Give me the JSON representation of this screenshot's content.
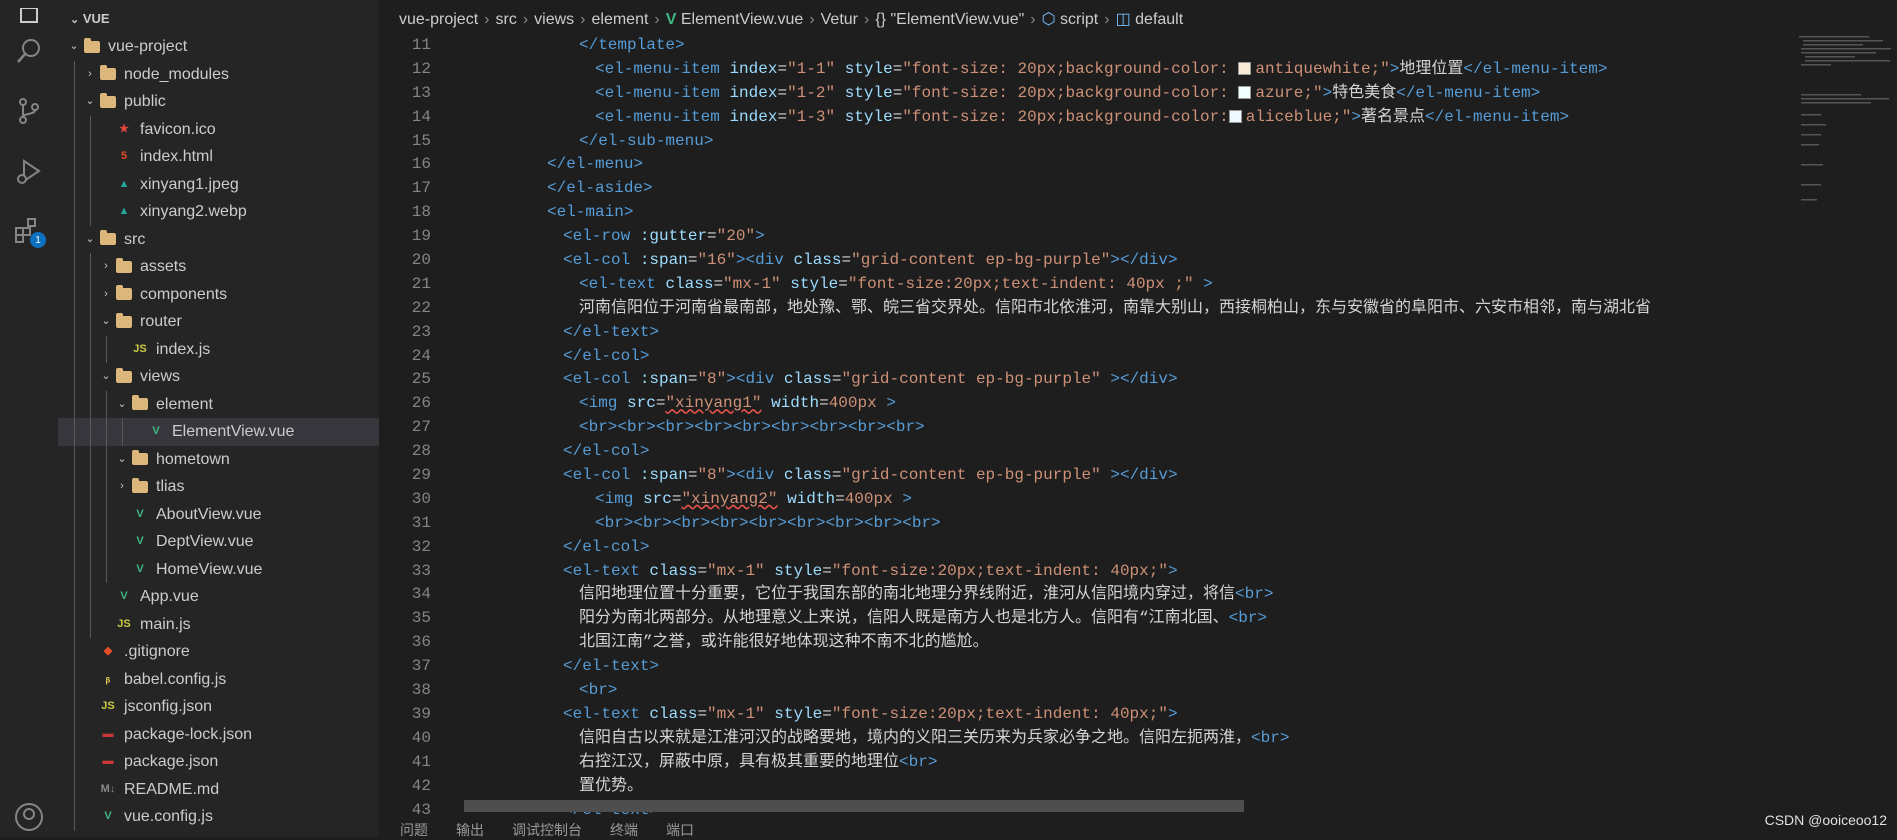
{
  "explorer": {
    "header": "VUE",
    "items": [
      {
        "label": "vue-project",
        "depth": 1,
        "type": "folder",
        "open": true
      },
      {
        "label": "node_modules",
        "depth": 2,
        "type": "folder",
        "open": false
      },
      {
        "label": "public",
        "depth": 2,
        "type": "folder",
        "open": true
      },
      {
        "label": "favicon.ico",
        "depth": 3,
        "type": "favicon"
      },
      {
        "label": "index.html",
        "depth": 3,
        "type": "html"
      },
      {
        "label": "xinyang1.jpeg",
        "depth": 3,
        "type": "image"
      },
      {
        "label": "xinyang2.webp",
        "depth": 3,
        "type": "image"
      },
      {
        "label": "src",
        "depth": 2,
        "type": "folder",
        "open": true
      },
      {
        "label": "assets",
        "depth": 3,
        "type": "folder",
        "open": false
      },
      {
        "label": "components",
        "depth": 3,
        "type": "folder",
        "open": false
      },
      {
        "label": "router",
        "depth": 3,
        "type": "folder",
        "open": true
      },
      {
        "label": "index.js",
        "depth": 4,
        "type": "js"
      },
      {
        "label": "views",
        "depth": 3,
        "type": "folder",
        "open": true
      },
      {
        "label": "element",
        "depth": 4,
        "type": "folder",
        "open": true
      },
      {
        "label": "ElementView.vue",
        "depth": 5,
        "type": "vue",
        "selected": true
      },
      {
        "label": "hometown",
        "depth": 4,
        "type": "folder",
        "open": true
      },
      {
        "label": "tlias",
        "depth": 4,
        "type": "folder",
        "open": false
      },
      {
        "label": "AboutView.vue",
        "depth": 4,
        "type": "vue"
      },
      {
        "label": "DeptView.vue",
        "depth": 4,
        "type": "vue"
      },
      {
        "label": "HomeView.vue",
        "depth": 4,
        "type": "vue"
      },
      {
        "label": "App.vue",
        "depth": 3,
        "type": "vue"
      },
      {
        "label": "main.js",
        "depth": 3,
        "type": "js"
      },
      {
        "label": ".gitignore",
        "depth": 2,
        "type": "git"
      },
      {
        "label": "babel.config.js",
        "depth": 2,
        "type": "babel"
      },
      {
        "label": "jsconfig.json",
        "depth": 2,
        "type": "js"
      },
      {
        "label": "package-lock.json",
        "depth": 2,
        "type": "npm"
      },
      {
        "label": "package.json",
        "depth": 2,
        "type": "npm"
      },
      {
        "label": "README.md",
        "depth": 2,
        "type": "md"
      },
      {
        "label": "vue.config.js",
        "depth": 2,
        "type": "vue"
      }
    ]
  },
  "breadcrumb": [
    "vue-project",
    "src",
    "views",
    "element",
    "ElementView.vue",
    "Vetur",
    "{} \"ElementView.vue\"",
    "script",
    "default"
  ],
  "editor": {
    "lines": [
      {
        "n": "11",
        "indent": 6,
        "parts": [
          [
            "tag",
            "</template>"
          ]
        ]
      },
      {
        "n": "12",
        "indent": 7,
        "parts": [
          [
            "tag",
            "<el-menu-item"
          ],
          [
            "txt",
            " "
          ],
          [
            "attr",
            "index"
          ],
          [
            "txt",
            "="
          ],
          [
            "str",
            "\"1-1\""
          ],
          [
            "txt",
            " "
          ],
          [
            "attr",
            "style"
          ],
          [
            "txt",
            "="
          ],
          [
            "str",
            "\"font-size: 20px;background-color: "
          ],
          [
            "swatch",
            "antiquewhite"
          ],
          [
            "str",
            "antiquewhite;\""
          ],
          [
            "tag",
            ">"
          ],
          [
            "txt",
            "地理位置"
          ],
          [
            "tag",
            "</el-menu-item>"
          ]
        ]
      },
      {
        "n": "13",
        "indent": 7,
        "parts": [
          [
            "tag",
            "<el-menu-item"
          ],
          [
            "txt",
            " "
          ],
          [
            "attr",
            "index"
          ],
          [
            "txt",
            "="
          ],
          [
            "str",
            "\"1-2\""
          ],
          [
            "txt",
            " "
          ],
          [
            "attr",
            "style"
          ],
          [
            "txt",
            "="
          ],
          [
            "str",
            "\"font-size: 20px;background-color: "
          ],
          [
            "swatch",
            "azure"
          ],
          [
            "str",
            "azure;\""
          ],
          [
            "tag",
            ">"
          ],
          [
            "txt",
            "特色美食"
          ],
          [
            "tag",
            "</el-menu-item>"
          ]
        ]
      },
      {
        "n": "14",
        "indent": 7,
        "parts": [
          [
            "tag",
            "<el-menu-item"
          ],
          [
            "txt",
            " "
          ],
          [
            "attr",
            "index"
          ],
          [
            "txt",
            "="
          ],
          [
            "str",
            "\"1-3\""
          ],
          [
            "txt",
            " "
          ],
          [
            "attr",
            "style"
          ],
          [
            "txt",
            "="
          ],
          [
            "str",
            "\"font-size: 20px;background-color:"
          ],
          [
            "swatch",
            "aliceblue"
          ],
          [
            "str",
            "aliceblue;\""
          ],
          [
            "tag",
            ">"
          ],
          [
            "txt",
            "著名景点"
          ],
          [
            "tag",
            "</el-menu-item>"
          ]
        ]
      },
      {
        "n": "15",
        "indent": 6,
        "parts": [
          [
            "tag",
            "</el-sub-menu>"
          ]
        ]
      },
      {
        "n": "16",
        "indent": 4,
        "parts": [
          [
            "tag",
            "</el-menu>"
          ]
        ]
      },
      {
        "n": "17",
        "indent": 4,
        "parts": [
          [
            "tag",
            "</el-aside>"
          ]
        ]
      },
      {
        "n": "18",
        "indent": 4,
        "parts": [
          [
            "tag",
            "<el-main>"
          ]
        ]
      },
      {
        "n": "19",
        "indent": 5,
        "parts": [
          [
            "tag",
            "<el-row"
          ],
          [
            "txt",
            " "
          ],
          [
            "attr",
            ":gutter"
          ],
          [
            "txt",
            "="
          ],
          [
            "str",
            "\"20\""
          ],
          [
            "tag",
            ">"
          ]
        ]
      },
      {
        "n": "20",
        "indent": 5,
        "parts": [
          [
            "tag",
            "<el-col"
          ],
          [
            "txt",
            " "
          ],
          [
            "attr",
            ":span"
          ],
          [
            "txt",
            "="
          ],
          [
            "str",
            "\"16\""
          ],
          [
            "tag",
            "><div"
          ],
          [
            "txt",
            " "
          ],
          [
            "attr",
            "class"
          ],
          [
            "txt",
            "="
          ],
          [
            "str",
            "\"grid-content ep-bg-purple\""
          ],
          [
            "tag",
            "></div>"
          ]
        ]
      },
      {
        "n": "21",
        "indent": 6,
        "parts": [
          [
            "tag",
            "<el-text"
          ],
          [
            "txt",
            " "
          ],
          [
            "attr",
            "class"
          ],
          [
            "txt",
            "="
          ],
          [
            "str",
            "\"mx-1\""
          ],
          [
            "txt",
            " "
          ],
          [
            "attr",
            "style"
          ],
          [
            "txt",
            "="
          ],
          [
            "str",
            "\"font-size:20px;text-indent: 40px ;\""
          ],
          [
            "txt",
            " "
          ],
          [
            "tag",
            ">"
          ]
        ]
      },
      {
        "n": "22",
        "indent": 6,
        "parts": [
          [
            "txt",
            "河南信阳位于河南省最南部，地处豫、鄂、皖三省交界处。信阳市北依淮河，南靠大别山，西接桐柏山，东与安徽省的阜阳市、六安市相邻，南与湖北省"
          ]
        ]
      },
      {
        "n": "23",
        "indent": 5,
        "parts": [
          [
            "tag",
            "</el-text>"
          ]
        ]
      },
      {
        "n": "24",
        "indent": 5,
        "parts": [
          [
            "tag",
            "</el-col>"
          ]
        ]
      },
      {
        "n": "25",
        "indent": 5,
        "parts": [
          [
            "tag",
            "<el-col"
          ],
          [
            "txt",
            " "
          ],
          [
            "attr",
            ":span"
          ],
          [
            "txt",
            "="
          ],
          [
            "str",
            "\"8\""
          ],
          [
            "tag",
            "><div"
          ],
          [
            "txt",
            " "
          ],
          [
            "attr",
            "class"
          ],
          [
            "txt",
            "="
          ],
          [
            "str",
            "\"grid-content ep-bg-purple\""
          ],
          [
            "txt",
            " "
          ],
          [
            "tag",
            "></div>"
          ]
        ]
      },
      {
        "n": "26",
        "indent": 6,
        "parts": [
          [
            "tag",
            "<img"
          ],
          [
            "txt",
            " "
          ],
          [
            "attr",
            "src"
          ],
          [
            "txt",
            "="
          ],
          [
            "str",
            "\"xinyang1\""
          ],
          [
            "txt",
            " "
          ],
          [
            "attr",
            "width"
          ],
          [
            "txt",
            "="
          ],
          [
            "str",
            "400px"
          ],
          [
            "txt",
            " "
          ],
          [
            "tag",
            ">"
          ]
        ]
      },
      {
        "n": "27",
        "indent": 6,
        "parts": [
          [
            "tag",
            "<br><br><br><br><br><br><br><br><br>"
          ]
        ]
      },
      {
        "n": "28",
        "indent": 5,
        "parts": [
          [
            "tag",
            "</el-col>"
          ]
        ]
      },
      {
        "n": "29",
        "indent": 5,
        "parts": [
          [
            "tag",
            "<el-col"
          ],
          [
            "txt",
            " "
          ],
          [
            "attr",
            ":span"
          ],
          [
            "txt",
            "="
          ],
          [
            "str",
            "\"8\""
          ],
          [
            "tag",
            "><div"
          ],
          [
            "txt",
            " "
          ],
          [
            "attr",
            "class"
          ],
          [
            "txt",
            "="
          ],
          [
            "str",
            "\"grid-content ep-bg-purple\""
          ],
          [
            "txt",
            " "
          ],
          [
            "tag",
            "></div>"
          ]
        ]
      },
      {
        "n": "30",
        "indent": 7,
        "parts": [
          [
            "tag",
            "<img"
          ],
          [
            "txt",
            " "
          ],
          [
            "attr",
            "src"
          ],
          [
            "txt",
            "="
          ],
          [
            "str",
            "\"xinyang2\""
          ],
          [
            "txt",
            " "
          ],
          [
            "attr",
            "width"
          ],
          [
            "txt",
            "="
          ],
          [
            "str",
            "400px"
          ],
          [
            "txt",
            " "
          ],
          [
            "tag",
            ">"
          ]
        ]
      },
      {
        "n": "31",
        "indent": 7,
        "parts": [
          [
            "tag",
            "<br><br><br><br><br><br><br><br><br>"
          ]
        ]
      },
      {
        "n": "32",
        "indent": 5,
        "parts": [
          [
            "tag",
            "</el-col>"
          ]
        ]
      },
      {
        "n": "33",
        "indent": 5,
        "parts": [
          [
            "tag",
            "<el-text"
          ],
          [
            "txt",
            " "
          ],
          [
            "attr",
            "class"
          ],
          [
            "txt",
            "="
          ],
          [
            "str",
            "\"mx-1\""
          ],
          [
            "txt",
            " "
          ],
          [
            "attr",
            "style"
          ],
          [
            "txt",
            "="
          ],
          [
            "str",
            "\"font-size:20px;text-indent: 40px;\""
          ],
          [
            "tag",
            ">"
          ]
        ]
      },
      {
        "n": "34",
        "indent": 6,
        "parts": [
          [
            "txt",
            "信阳地理位置十分重要，它位于我国东部的南北地理分界线附近，淮河从信阳境内穿过，将信"
          ],
          [
            "tag",
            "<br>"
          ]
        ]
      },
      {
        "n": "35",
        "indent": 6,
        "parts": [
          [
            "txt",
            "阳分为南北两部分。从地理意义上来说，信阳人既是南方人也是北方人。信阳有“江南北国、"
          ],
          [
            "tag",
            "<br>"
          ]
        ]
      },
      {
        "n": "36",
        "indent": 6,
        "parts": [
          [
            "txt",
            "北国江南”之誉，或许能很好地体现这种不南不北的尴尬。"
          ]
        ]
      },
      {
        "n": "37",
        "indent": 5,
        "parts": [
          [
            "tag",
            "</el-text>"
          ]
        ]
      },
      {
        "n": "38",
        "indent": 6,
        "parts": [
          [
            "tag",
            "<br>"
          ]
        ]
      },
      {
        "n": "39",
        "indent": 5,
        "parts": [
          [
            "tag",
            "<el-text"
          ],
          [
            "txt",
            " "
          ],
          [
            "attr",
            "class"
          ],
          [
            "txt",
            "="
          ],
          [
            "str",
            "\"mx-1\""
          ],
          [
            "txt",
            " "
          ],
          [
            "attr",
            "style"
          ],
          [
            "txt",
            "="
          ],
          [
            "str",
            "\"font-size:20px;text-indent: 40px;\""
          ],
          [
            "tag",
            ">"
          ]
        ]
      },
      {
        "n": "40",
        "indent": 6,
        "parts": [
          [
            "txt",
            "信阳自古以来就是江淮河汉的战略要地，境内的义阳三关历来为兵家必争之地。信阳左扼两淮，"
          ],
          [
            "tag",
            "<br>"
          ]
        ]
      },
      {
        "n": "41",
        "indent": 6,
        "parts": [
          [
            "txt",
            "右控江汉，屏蔽中原，具有极其重要的地理位"
          ],
          [
            "tag",
            "<br>"
          ]
        ]
      },
      {
        "n": "42",
        "indent": 6,
        "parts": [
          [
            "txt",
            "置优势。"
          ]
        ]
      },
      {
        "n": "43",
        "indent": 5,
        "parts": [
          [
            "tag",
            "</el-text>"
          ]
        ]
      }
    ]
  },
  "panel": {
    "tabs": [
      "问题",
      "输出",
      "调试控制台",
      "终端",
      "端口"
    ]
  },
  "watermark": "CSDN @ooiceoo12",
  "activity_badge": "1",
  "colors": {
    "accent": "#0e70c0",
    "tag": "#569cd6",
    "attr": "#9cdcfe",
    "string": "#ce9178",
    "folder": "#dcb67a",
    "vue": "#41b883",
    "js": "#cbcb41"
  }
}
